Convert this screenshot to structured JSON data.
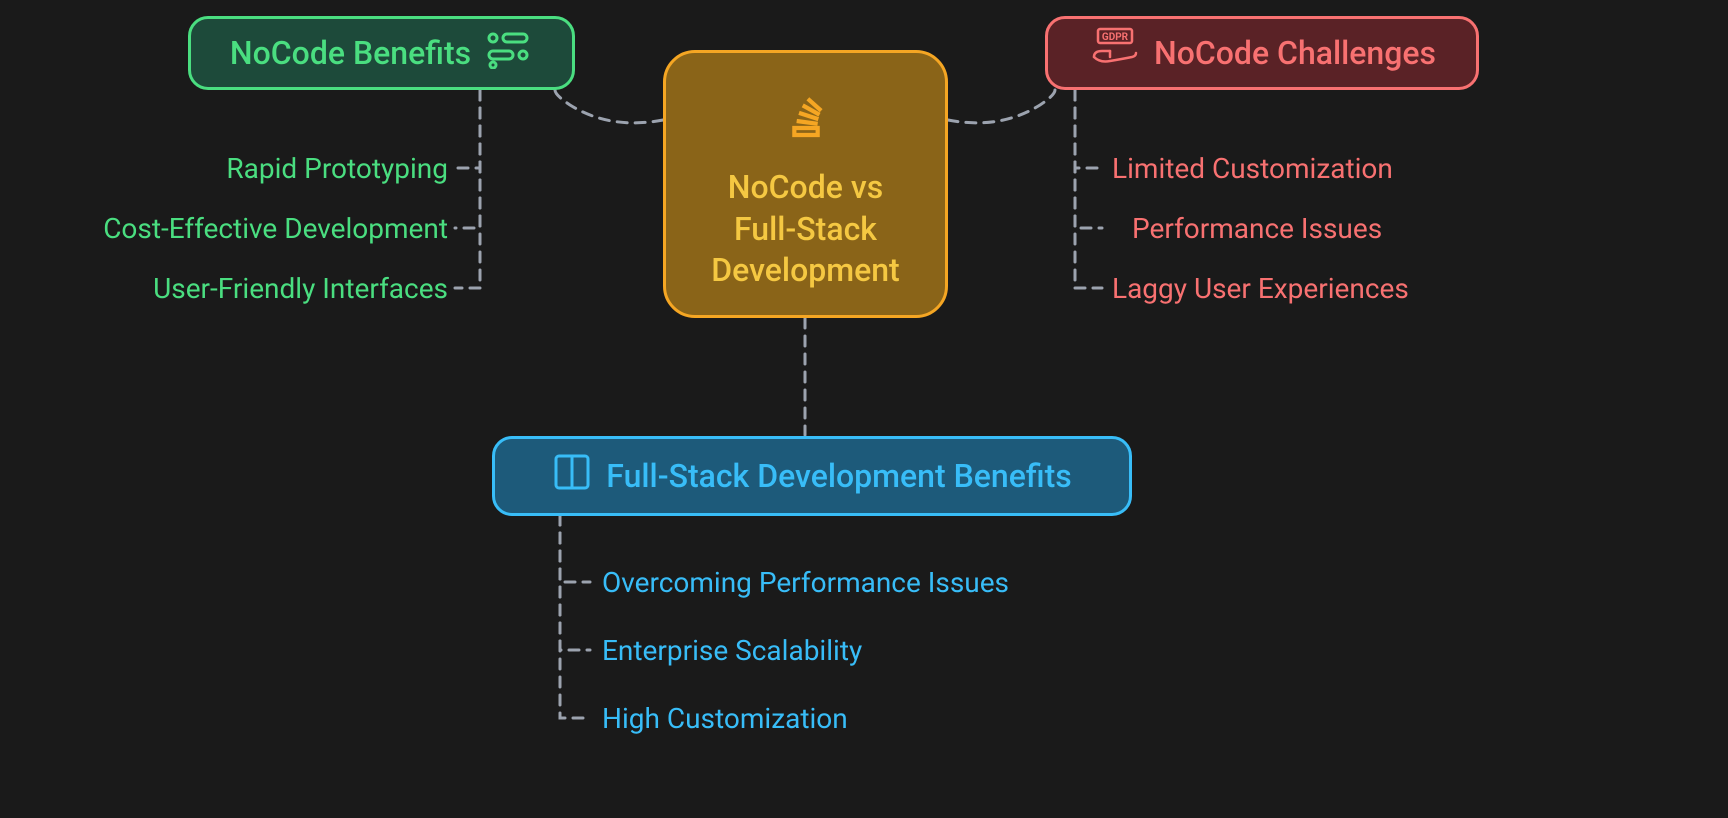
{
  "center": {
    "title": "NoCode vs\nFull-Stack\nDevelopment"
  },
  "greenNode": {
    "title": "NoCode Benefits",
    "items": [
      "Rapid Prototyping",
      "Cost-Effective Development",
      "User-Friendly Interfaces"
    ]
  },
  "redNode": {
    "title": "NoCode Challenges",
    "items": [
      "Limited Customization",
      "Performance Issues",
      "Laggy User Experiences"
    ]
  },
  "blueNode": {
    "title": "Full-Stack Development Benefits",
    "items": [
      "Overcoming Performance Issues",
      "Enterprise Scalability",
      "High Customization"
    ]
  },
  "colors": {
    "green": "#4ade80",
    "red": "#f87171",
    "blue": "#38bdf8",
    "orange": "#f5a623",
    "connector": "#9ca3af"
  }
}
